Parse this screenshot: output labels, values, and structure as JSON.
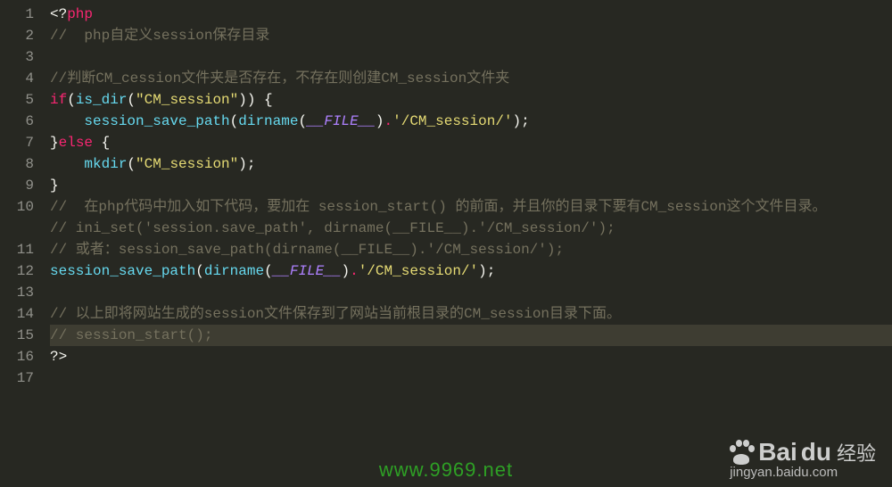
{
  "editor": {
    "lines": [
      {
        "num": 1,
        "tokens": [
          {
            "t": "<?",
            "c": "tag"
          },
          {
            "t": "php",
            "c": "keyword"
          }
        ]
      },
      {
        "num": 2,
        "tokens": [
          {
            "t": "//  php自定义session保存目录",
            "c": "comment"
          }
        ]
      },
      {
        "num": 3,
        "tokens": []
      },
      {
        "num": 4,
        "tokens": [
          {
            "t": "//判断CM_cession文件夹是否存在，不存在则创建CM_session文件夹",
            "c": "comment"
          }
        ]
      },
      {
        "num": 5,
        "tokens": [
          {
            "t": "if",
            "c": "keyword"
          },
          {
            "t": "(",
            "c": "punct"
          },
          {
            "t": "is_dir",
            "c": "func"
          },
          {
            "t": "(",
            "c": "punct"
          },
          {
            "t": "\"CM_session\"",
            "c": "string"
          },
          {
            "t": "))",
            "c": "punct"
          },
          {
            "t": " {",
            "c": "punct"
          }
        ]
      },
      {
        "num": 6,
        "tokens": [
          {
            "t": "    ",
            "c": "punct"
          },
          {
            "t": "session_save_path",
            "c": "func"
          },
          {
            "t": "(",
            "c": "punct"
          },
          {
            "t": "dirname",
            "c": "func"
          },
          {
            "t": "(",
            "c": "punct"
          },
          {
            "t": "__FILE__",
            "c": "const"
          },
          {
            "t": ")",
            "c": "punct"
          },
          {
            "t": ".",
            "c": "op"
          },
          {
            "t": "'/CM_session/'",
            "c": "string"
          },
          {
            "t": ");",
            "c": "punct"
          }
        ]
      },
      {
        "num": 7,
        "tokens": [
          {
            "t": "}",
            "c": "punct"
          },
          {
            "t": "else",
            "c": "keyword"
          },
          {
            "t": " {",
            "c": "punct"
          }
        ]
      },
      {
        "num": 8,
        "tokens": [
          {
            "t": "    ",
            "c": "punct"
          },
          {
            "t": "mkdir",
            "c": "func"
          },
          {
            "t": "(",
            "c": "punct"
          },
          {
            "t": "\"CM_session\"",
            "c": "string"
          },
          {
            "t": ");",
            "c": "punct"
          }
        ]
      },
      {
        "num": 9,
        "tokens": [
          {
            "t": "}",
            "c": "punct"
          }
        ]
      },
      {
        "num": 10,
        "wrap": true,
        "tokens": [
          {
            "t": "//  在php代码中加入如下代码，要加在 session_start() 的前面，并且你的目录下要有CM_session这个文件目录。",
            "c": "comment"
          }
        ]
      },
      {
        "num": 11,
        "tokens": [
          {
            "t": "// ini_set('session.save_path', dirname(__FILE__).'/CM_session/');",
            "c": "comment"
          }
        ]
      },
      {
        "num": 12,
        "tokens": [
          {
            "t": "// 或者：session_save_path(dirname(__FILE__).'/CM_session/');",
            "c": "comment"
          }
        ]
      },
      {
        "num": 13,
        "tokens": [
          {
            "t": "session_save_path",
            "c": "func"
          },
          {
            "t": "(",
            "c": "punct"
          },
          {
            "t": "dirname",
            "c": "func"
          },
          {
            "t": "(",
            "c": "punct"
          },
          {
            "t": "__FILE__",
            "c": "const"
          },
          {
            "t": ")",
            "c": "punct"
          },
          {
            "t": ".",
            "c": "op"
          },
          {
            "t": "'/CM_session/'",
            "c": "string"
          },
          {
            "t": ");",
            "c": "punct"
          }
        ]
      },
      {
        "num": 14,
        "tokens": []
      },
      {
        "num": 15,
        "tokens": [
          {
            "t": "// 以上即将网站生成的session文件保存到了网站当前根目录的CM_session目录下面。",
            "c": "comment"
          }
        ]
      },
      {
        "num": 16,
        "highlighted": true,
        "tokens": [
          {
            "t": "// session_start();",
            "c": "comment"
          }
        ]
      },
      {
        "num": 17,
        "tokens": [
          {
            "t": "?>",
            "c": "tag"
          }
        ]
      }
    ]
  },
  "watermark": {
    "url": "www.9969.net",
    "baidu_bai": "Bai",
    "baidu_du": "du",
    "baidu_jy": "经验",
    "baidu_sub": "jingyan.baidu.com"
  }
}
